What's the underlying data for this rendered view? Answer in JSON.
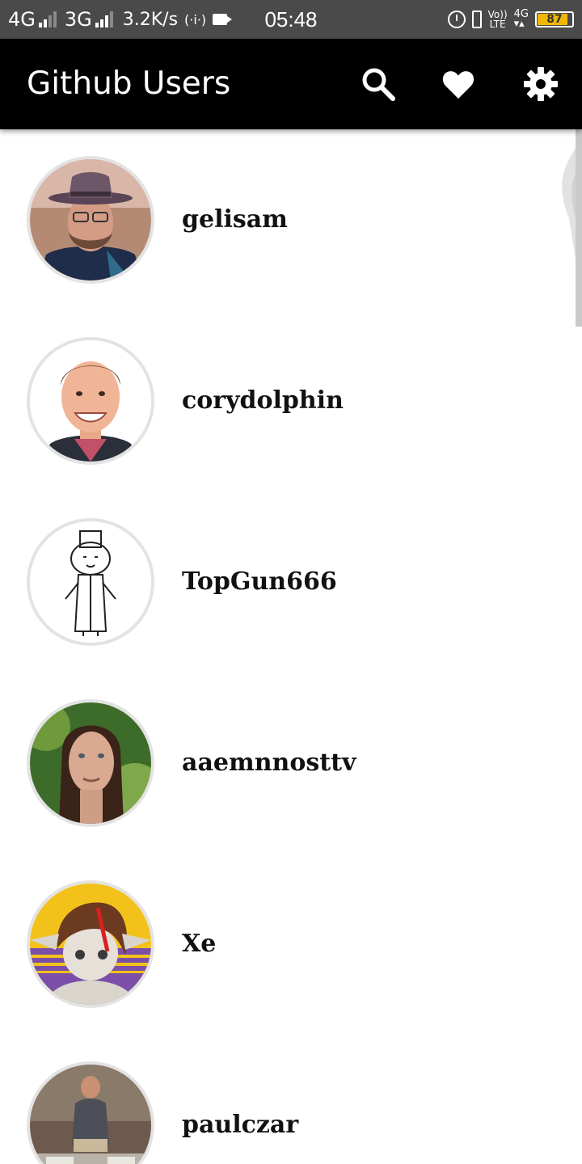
{
  "status_bar": {
    "net1": "4G",
    "net2": "3G",
    "speed": "3.2K/s",
    "hotspot": "(·i·)",
    "time": "05:48",
    "volte_top": "Vo))",
    "volte_bottom": "LTE",
    "net4g": "4G",
    "battery": "87",
    "battery_level": 0.87,
    "battery_color": "#f2b705"
  },
  "app_bar": {
    "title": "Github Users",
    "background": "#000000",
    "actions": [
      {
        "icon": "search-icon"
      },
      {
        "icon": "heart-icon"
      },
      {
        "icon": "gear-icon"
      }
    ]
  },
  "users": [
    {
      "login": "gelisam",
      "avatar": "photo-man-hat"
    },
    {
      "login": "corydolphin",
      "avatar": "photo-man-smiling"
    },
    {
      "login": "TopGun666",
      "avatar": "sketch-character"
    },
    {
      "login": "aaemnnosttv",
      "avatar": "photo-man-long-hair"
    },
    {
      "login": "Xe",
      "avatar": "anime-character"
    },
    {
      "login": "paulczar",
      "avatar": "photo-man-sitting"
    }
  ]
}
